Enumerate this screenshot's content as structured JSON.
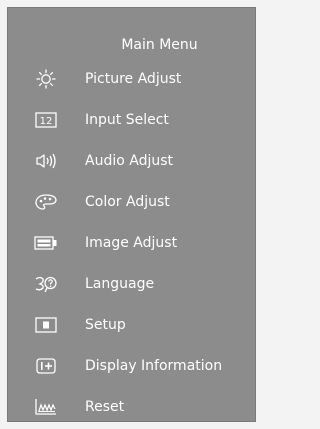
{
  "menu": {
    "title": "Main Menu",
    "items": [
      {
        "label": "Picture Adjust",
        "icon": "sun-icon"
      },
      {
        "label": "Input Select",
        "icon": "input-select-icon",
        "icon_text": "12"
      },
      {
        "label": "Audio Adjust",
        "icon": "speaker-icon"
      },
      {
        "label": "Color Adjust",
        "icon": "palette-icon"
      },
      {
        "label": "Image Adjust",
        "icon": "image-adjust-icon"
      },
      {
        "label": "Language",
        "icon": "language-icon"
      },
      {
        "label": "Setup",
        "icon": "setup-icon"
      },
      {
        "label": "Display Information",
        "icon": "info-icon"
      },
      {
        "label": "Reset",
        "icon": "reset-icon"
      }
    ]
  }
}
